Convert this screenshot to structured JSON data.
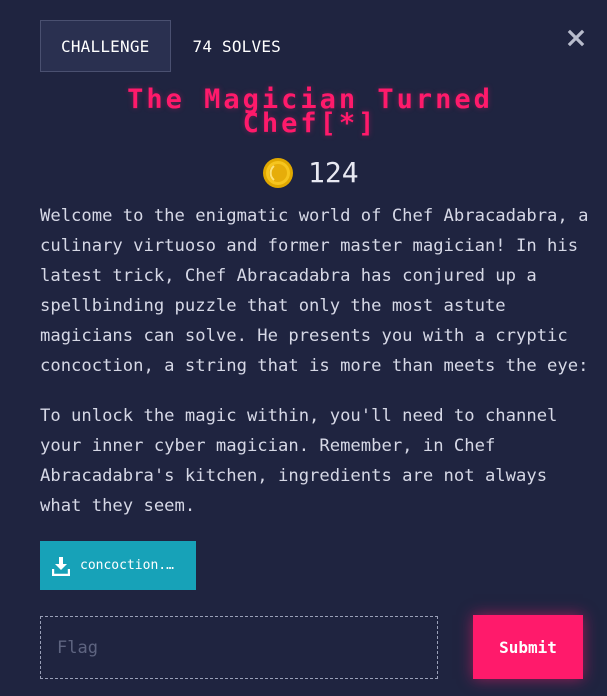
{
  "tabs": [
    {
      "label": "CHALLENGE",
      "active": true
    },
    {
      "label": "74 SOLVES",
      "active": false
    }
  ],
  "close_icon": "close-icon",
  "challenge": {
    "title_line1": "The Magician Turned",
    "title_line2": "Chef[*]",
    "points": "124",
    "coin_icon": "coin-icon",
    "description": [
      "Welcome to the enigmatic world of Chef Abracadabra, a culinary virtuoso and former master magician! In his latest trick, Chef Abracadabra has conjured up a spellbinding puzzle that only the most astute magicians can solve. He presents you with a cryptic concoction, a string that is more than meets the eye:",
      "To unlock the magic within, you'll need to channel your inner cyber magician. Remember, in Chef Abracadabra's kitchen, ingredients are not always what they seem."
    ]
  },
  "file": {
    "label": "concoction.…",
    "icon": "download-icon"
  },
  "flag": {
    "placeholder": "Flag",
    "value": ""
  },
  "submit_label": "Submit",
  "colors": {
    "background": "#1f2440",
    "accent": "#ff1a6b",
    "file_button": "#17a2b8"
  }
}
